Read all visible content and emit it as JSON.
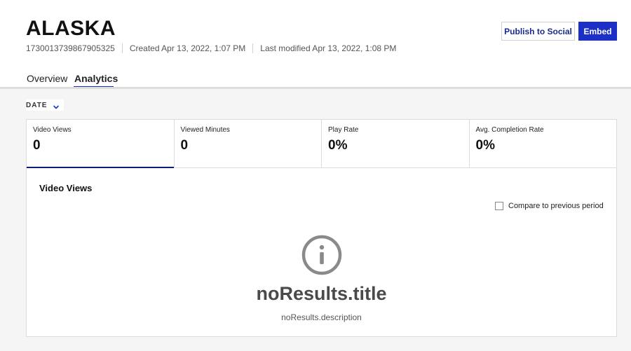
{
  "asset": {
    "title": "ALASKA",
    "id": "1730013739867905325",
    "created": "Created Apr 13, 2022, 1:07 PM",
    "modified": "Last modified Apr 13, 2022, 1:08 PM"
  },
  "actions": {
    "publish_label": "Publish to Social",
    "embed_label": "Embed"
  },
  "tabs": [
    {
      "label": "Overview",
      "active": false
    },
    {
      "label": "Analytics",
      "active": true
    }
  ],
  "filter": {
    "date_label": "DATE",
    "icon": "chevron-down-icon"
  },
  "metrics": [
    {
      "label": "Video Views",
      "value": "0",
      "active": true
    },
    {
      "label": "Viewed Minutes",
      "value": "0",
      "active": false
    },
    {
      "label": "Play Rate",
      "value": "0%",
      "active": false
    },
    {
      "label": "Avg. Completion Rate",
      "value": "0%",
      "active": false
    }
  ],
  "chart": {
    "title": "Video Views",
    "compare_label": "Compare to previous period",
    "compare_checked": false
  },
  "no_results": {
    "icon": "info-icon",
    "title": "noResults.title",
    "description": "noResults.description"
  },
  "colors": {
    "accent": "#1c2fc7",
    "active_tab_indicator": "#0b1d7a",
    "icon_gray": "#8a8a8a"
  }
}
